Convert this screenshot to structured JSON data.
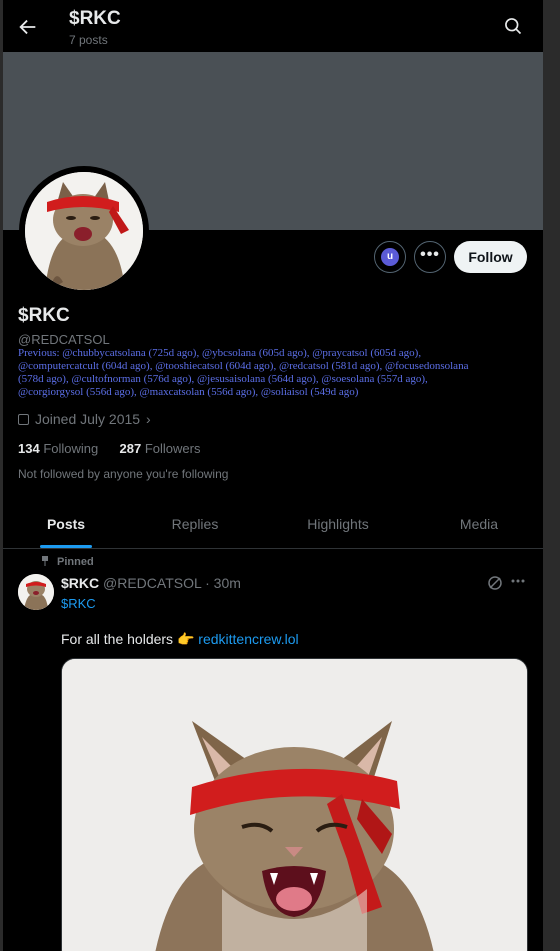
{
  "header": {
    "title": "$RKC",
    "post_count": "7 posts"
  },
  "profile": {
    "name": "$RKC",
    "handle": "@REDCATSOL",
    "previous_lines": [
      "Previous: @chubbycatsolana (725d ago), @ybcsolana (605d ago), @praycatsol (605d ago),",
      "@computercatcult (604d ago), @tooshiecatsol (604d ago), @redcatsol (581d ago), @focusedonsolana",
      "(578d ago), @cultofnorman (576d ago), @jesusaisolana (564d ago), @soesolana (557d ago),",
      "@corgiorgysol (556d ago), @maxcatsolan (556d ago), @soliaisol (549d ago)"
    ],
    "joined": "Joined July 2015",
    "following_count": "134",
    "following_label": "Following",
    "followers_count": "287",
    "followers_label": "Followers",
    "not_followed": "Not followed by anyone you're following"
  },
  "actions": {
    "badge_letter": "u",
    "more": "•••",
    "follow_label": "Follow"
  },
  "tabs": [
    {
      "label": "Posts"
    },
    {
      "label": "Replies"
    },
    {
      "label": "Highlights"
    },
    {
      "label": "Media"
    }
  ],
  "post": {
    "pinned_label": "Pinned",
    "author": "$RKC",
    "handle_time": "@REDCATSOL · 30m",
    "tag": "$RKC",
    "text": "For all the holders 👉",
    "link": "redkittencrew.lol"
  },
  "icons": {
    "back": "arrow-left-icon",
    "search": "search-icon",
    "calendar": "calendar-icon",
    "pin": "pin-icon",
    "grok": "grok-icon",
    "more": "more-icon"
  },
  "colors": {
    "accent": "#1d9bf0",
    "previous_text": "#5c6fe8",
    "banner": "#4a5055",
    "background": "#000000"
  }
}
